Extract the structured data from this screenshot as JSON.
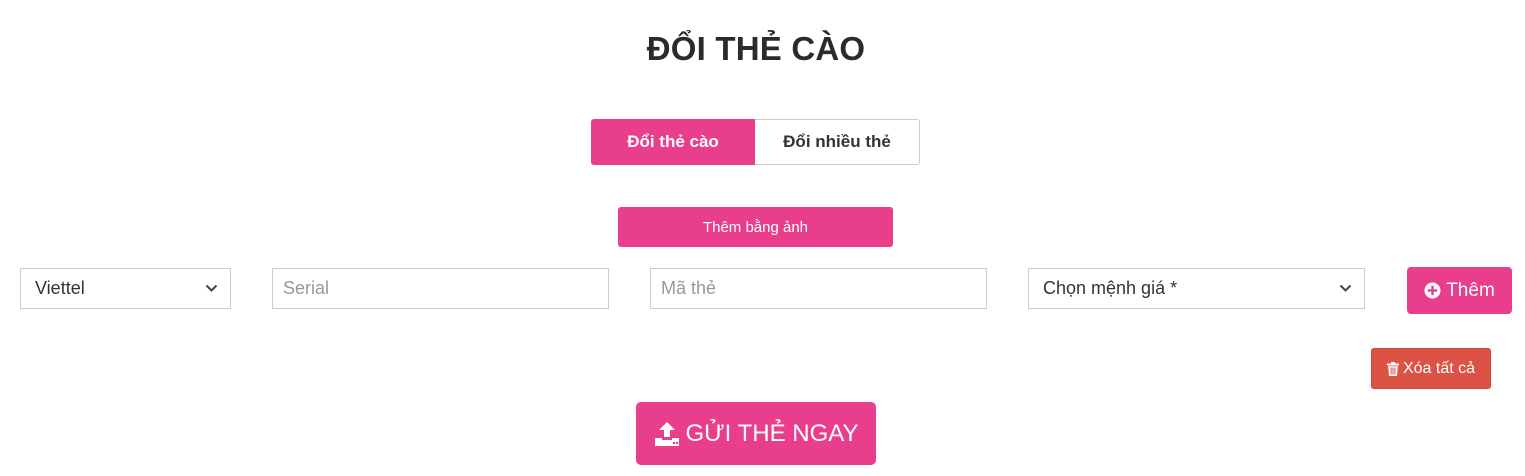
{
  "page": {
    "title": "ĐỔI THẺ CÀO"
  },
  "tabs": [
    {
      "label": "Đổi thẻ cào",
      "active": true
    },
    {
      "label": "Đổi nhiều thẻ",
      "active": false
    }
  ],
  "image_button": {
    "label": "Thêm bằng ảnh"
  },
  "form": {
    "carrier": {
      "selected": "Viettel"
    },
    "serial": {
      "value": "",
      "placeholder": "Serial"
    },
    "code": {
      "value": "",
      "placeholder": "Mã thẻ"
    },
    "denomination": {
      "selected": "Chọn mệnh giá *"
    }
  },
  "add_button": {
    "label": "Thêm",
    "icon": "plus-circle-icon"
  },
  "clear_button": {
    "label": "Xóa tất cả",
    "icon": "trash-icon"
  },
  "submit_button": {
    "label": "GỬI THẺ NGAY",
    "icon": "upload-icon"
  },
  "colors": {
    "primary": "#e83e8c",
    "danger": "#dc5245",
    "title": "#2b2b2b"
  }
}
